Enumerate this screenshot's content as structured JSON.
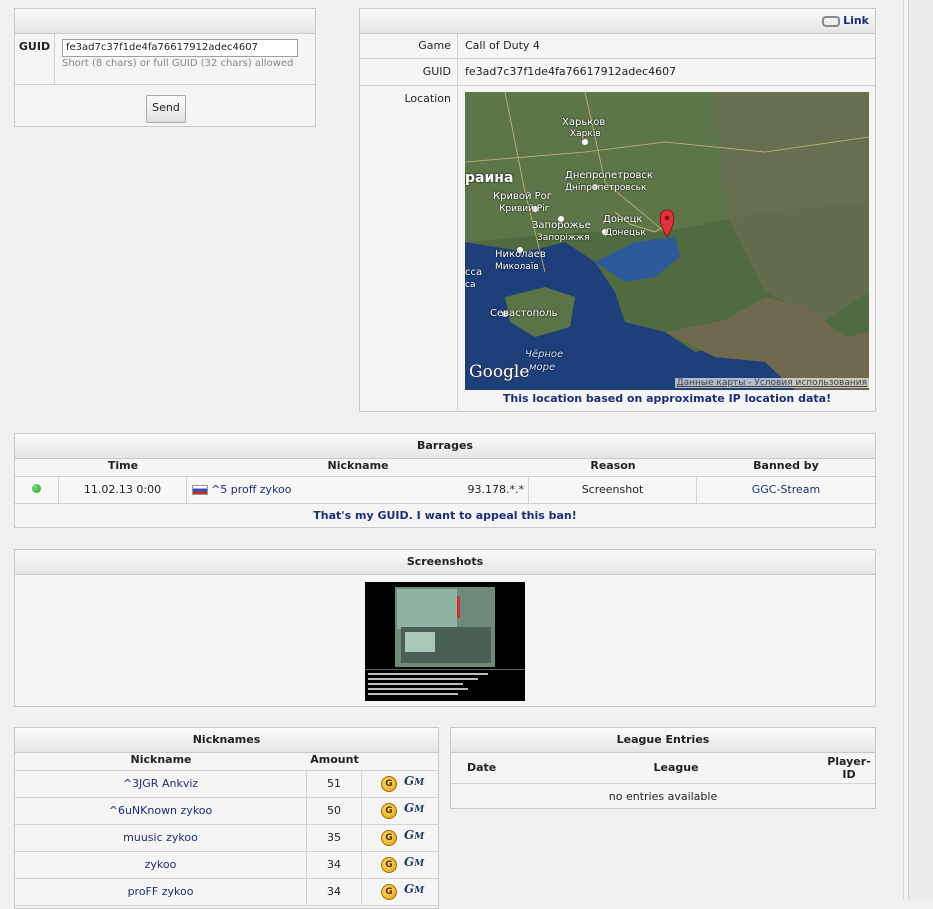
{
  "search": {
    "guid_label": "GUID",
    "guid_value": "fe3ad7c37f1de4fa76617912adec4607",
    "hint": "Short (8 chars) or full GUID (32 chars) allowed",
    "send_label": "Send"
  },
  "info": {
    "link_label": "Link",
    "rows": [
      {
        "label": "Game",
        "value": "Call of Duty 4"
      },
      {
        "label": "GUID",
        "value": "fe3ad7c37f1de4fa76617912adec4607"
      },
      {
        "label": "Location",
        "value": ""
      }
    ],
    "map": {
      "country_label": "раина",
      "cities": [
        "Харьков",
        "Харків",
        "Днепропетровск",
        "Дніпропетровськ",
        "Кривой Рог",
        "Кривий Ріг",
        "Запорожье",
        "Запоріжжя",
        "Донецк",
        "Донецьк",
        "Николаев",
        "Миколаїв",
        "сса",
        "са",
        "Севастополь",
        "Чёрное",
        "море"
      ],
      "google_label": "Google",
      "attribution": "Данные карты - Условия использования"
    },
    "location_note": "This location based on approximate IP location data!"
  },
  "barrages": {
    "title": "Barrages",
    "columns": [
      "Time",
      "Nickname",
      "Reason",
      "Banned by"
    ],
    "rows": [
      {
        "time": "11.02.13 0:00",
        "nickname": "^5 proff zykoo",
        "ip": "93.178.*.*",
        "reason": "Screenshot",
        "banned_by": "GGC-Stream"
      }
    ],
    "appeal_label": "That's my GUID. I want to appeal this ban!"
  },
  "screenshots": {
    "title": "Screenshots"
  },
  "nicknames": {
    "title": "Nicknames",
    "columns": [
      "Nickname",
      "Amount"
    ],
    "rows": [
      {
        "name": "^3JGR Ankviz",
        "amount": "51"
      },
      {
        "name": "^6uNKnown zykoo",
        "amount": "50"
      },
      {
        "name": "muusic zykoo",
        "amount": "35"
      },
      {
        "name": "zykoo",
        "amount": "34"
      },
      {
        "name": "proFF zykoo",
        "amount": "34"
      }
    ]
  },
  "league": {
    "title": "League Entries",
    "columns": [
      "Date",
      "League",
      "Player-ID"
    ],
    "empty_text": "no entries available"
  }
}
